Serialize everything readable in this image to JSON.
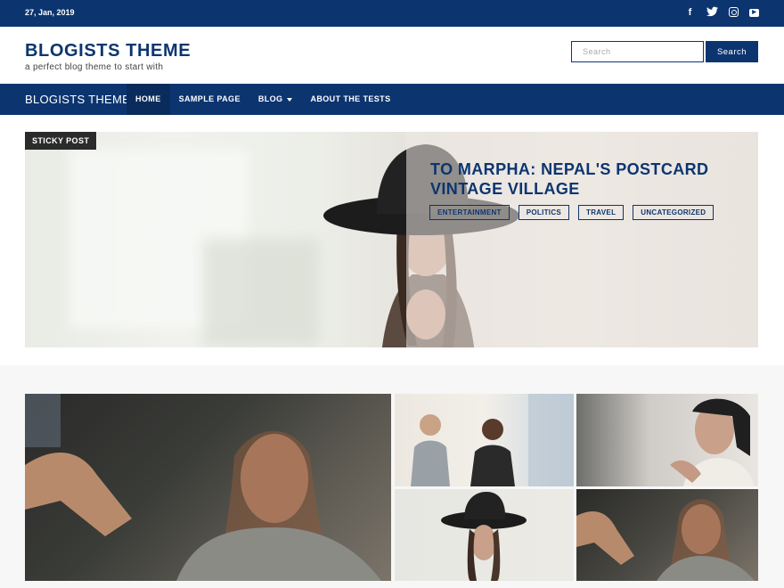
{
  "topbar": {
    "date": "27, Jan, 2019",
    "social": [
      "facebook-icon",
      "twitter-icon",
      "instagram-icon",
      "youtube-icon"
    ]
  },
  "header": {
    "site_title": "BLOGISTS THEME",
    "tagline": "a perfect blog theme to start with",
    "search_placeholder": "Search",
    "search_button": "Search"
  },
  "nav": {
    "brand": "BLOGISTS THEME",
    "items": [
      {
        "label": "HOME"
      },
      {
        "label": "SAMPLE PAGE"
      },
      {
        "label": "BLOG"
      },
      {
        "label": "ABOUT THE TESTS"
      }
    ]
  },
  "hero": {
    "badge": "STICKY POST",
    "title": "TO MARPHA: NEPAL'S POSTCARD VINTAGE VILLAGE",
    "tags": [
      "ENTERTAINMENT",
      "POLITICS",
      "TRAVEL",
      "UNCATEGORIZED"
    ]
  },
  "colors": {
    "brand": "#0c3570",
    "sticky_badge": "#2b2b2b"
  }
}
